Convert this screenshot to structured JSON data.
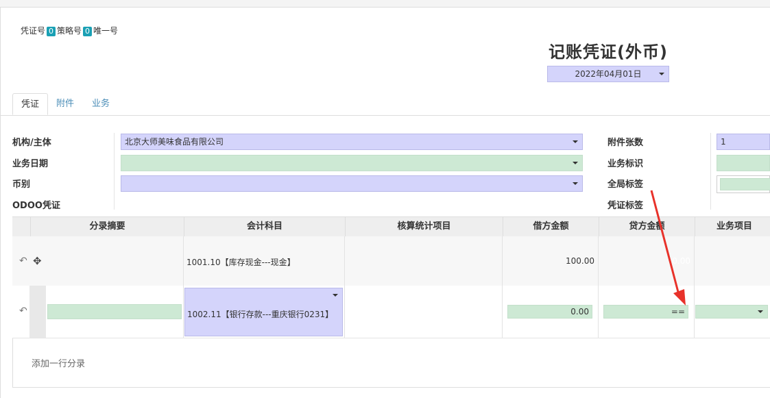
{
  "header": {
    "voucher_no_label": "凭证号",
    "voucher_no": "0",
    "strategy_no_label": "策略号",
    "strategy_no": "0",
    "unique_no_label": "唯一号",
    "title": "记账凭证(外币)",
    "date": "2022年04月01日"
  },
  "tabs": [
    "凭证",
    "附件",
    "业务"
  ],
  "form": {
    "entity_label": "机构/主体",
    "entity_value": "北京大师美味食品有限公司",
    "biz_date_label": "业务日期",
    "currency_label": "币别",
    "odoo_label": "ODOO凭证",
    "attach_count_label": "附件张数",
    "attach_count_value": "1",
    "biz_flag_label": "业务标识",
    "global_tag_label": "全局标签",
    "voucher_tag_label": "凭证标签"
  },
  "table": {
    "columns": [
      "分录摘要",
      "会计科目",
      "核算统计项目",
      "借方金额",
      "贷方金额",
      "业务项目"
    ],
    "rows": [
      {
        "account": "1001.10【库存现金---现金】",
        "debit": "100.00",
        "credit": "0.00"
      },
      {
        "account": "1002.11【银行存款---重庆银行0231】",
        "debit": "0.00",
        "credit": "=="
      }
    ],
    "add_line": "添加一行分录"
  },
  "colors": {
    "purple_field": "#d4d4fb",
    "green_field": "#cde9d4",
    "accent": "#1aa0b4",
    "arrow": "#e8322a"
  }
}
